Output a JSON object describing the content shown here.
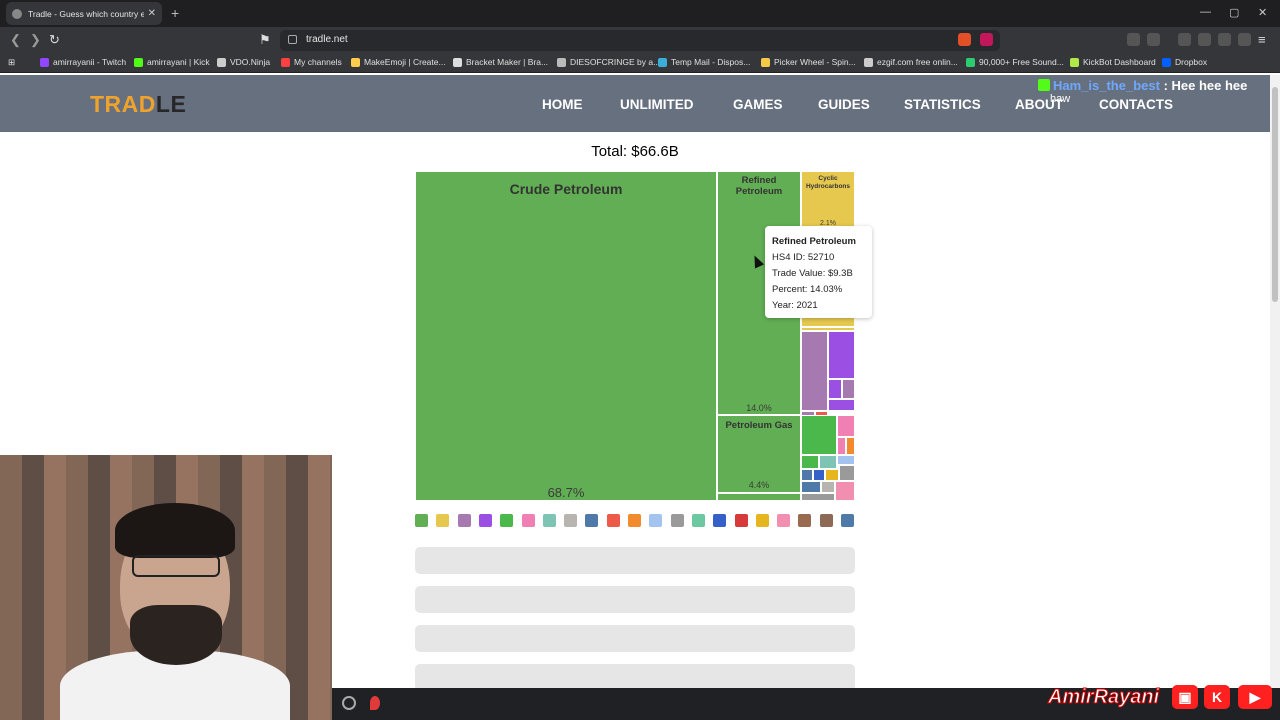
{
  "browser": {
    "tab_title": "Tradle - Guess which country exp",
    "new_tab": "+",
    "close_glyph": "✕",
    "url": "tradle.net",
    "window_controls": [
      "—",
      "▢",
      "✕"
    ],
    "bookmarks": [
      {
        "label": "amirrayanii - Twitch",
        "color": "#9146ff"
      },
      {
        "label": "amirrayani | Kick",
        "color": "#53fc18"
      },
      {
        "label": "VDO.Ninja",
        "color": "#cccccc"
      },
      {
        "label": "My channels",
        "color": "#ff4040"
      },
      {
        "label": "MakeEmoji | Create...",
        "color": "#ffcc4d"
      },
      {
        "label": "Bracket Maker | Bra...",
        "color": "#dddddd"
      },
      {
        "label": "DIESOFCRINGE by a...",
        "color": "#bbbbbb"
      },
      {
        "label": "Temp Mail - Dispos...",
        "color": "#3aaed8"
      },
      {
        "label": "Picker Wheel - Spin...",
        "color": "#f7c948"
      },
      {
        "label": "ezgif.com free onlin...",
        "color": "#cccccc"
      },
      {
        "label": "90,000+ Free Sound...",
        "color": "#2ecc71"
      },
      {
        "label": "KickBot Dashboard",
        "color": "#b0e84a"
      },
      {
        "label": "Dropbox",
        "color": "#0061fe"
      }
    ]
  },
  "site": {
    "logo_a": "TRAD",
    "logo_b": "LE",
    "menu": [
      "HOME",
      "UNLIMITED",
      "GAMES",
      "GUIDES",
      "STATISTICS",
      "ABOUT",
      "CONTACTS"
    ]
  },
  "chat": {
    "user": "Ham_is_the_best",
    "message": " : Hee hee hee",
    "sub": "haw"
  },
  "treemap": {
    "total": "Total: $66.6B",
    "cells": [
      {
        "name": "Crude Petroleum",
        "pct": "68.7%",
        "color": "#62ae54"
      },
      {
        "name": "Refined Petroleum",
        "pct": "14.0%",
        "color": "#62ae54"
      },
      {
        "name": "Petroleum Gas",
        "pct": "4.4%",
        "color": "#62ae54"
      },
      {
        "name": "Cyclic Hydrocarbons",
        "pct": "2.1%",
        "color": "#e6c84f"
      }
    ],
    "tooltip": {
      "title": "Refined Petroleum",
      "hs4": "HS4 ID: 52710",
      "value": "Trade Value: $9.3B",
      "percent": "Percent: 14.03%",
      "year": "Year: 2021"
    },
    "swatch_colors": [
      "#62ae54",
      "#e6c84f",
      "#a67ab0",
      "#9b4fe3",
      "#4ab84a",
      "#f07fb4",
      "#7ec4b4",
      "#b8b4b0",
      "#4f79a8",
      "#ee5a4a",
      "#f28a2e",
      "#a4c4f0",
      "#9a9a9a",
      "#6cc8a0",
      "#3560c8",
      "#d63a3a",
      "#e6b61e",
      "#f28fb0",
      "#9a6a50",
      "#8c6a55",
      "#4f79a8"
    ]
  },
  "overlay": {
    "brand": "AmirRayani",
    "icons": [
      "▣",
      "K",
      "▶"
    ]
  }
}
